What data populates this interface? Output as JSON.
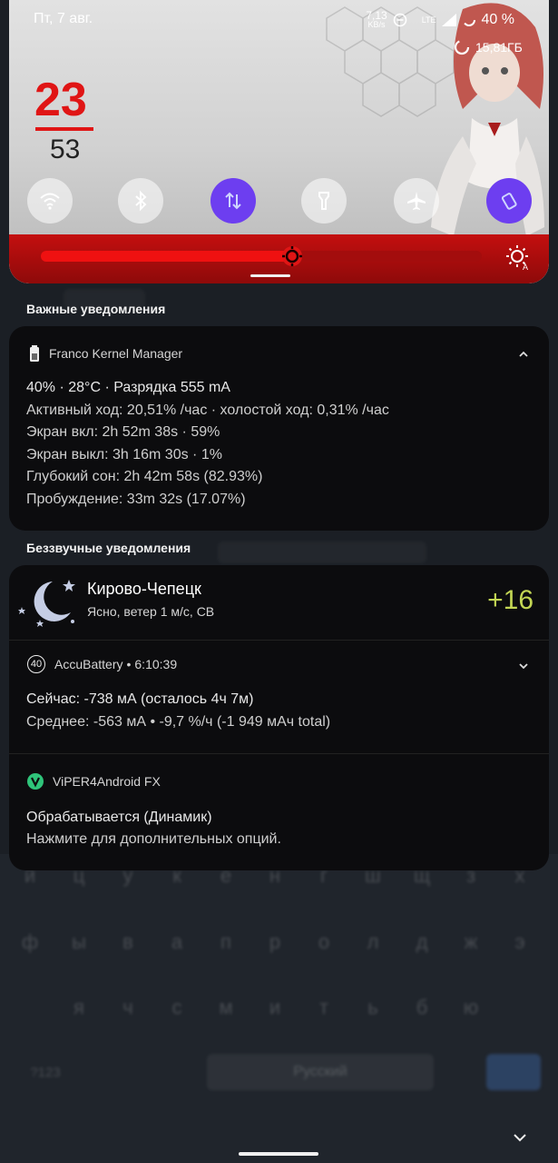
{
  "status_bar": {
    "date": "Пт, 7 авг.",
    "net_speed_value": "7,13",
    "net_speed_unit": "KB/s",
    "network": "LTE",
    "battery": "40 %"
  },
  "quick_settings": {
    "storage": "15,81ГБ",
    "clock_hour": "23",
    "clock_minute": "53",
    "tiles": [
      {
        "name": "wifi",
        "icon": "wifi-icon",
        "active": false
      },
      {
        "name": "bluetooth",
        "icon": "bluetooth-icon",
        "active": false
      },
      {
        "name": "mobile-data",
        "icon": "data-transfer-icon",
        "active": true
      },
      {
        "name": "flashlight",
        "icon": "flashlight-icon",
        "active": false
      },
      {
        "name": "airplane-mode",
        "icon": "airplane-icon",
        "active": false
      },
      {
        "name": "screen-rotation",
        "icon": "rotate-icon",
        "active": true
      }
    ],
    "brightness_level": 0.57,
    "accent_color": "#e01515",
    "active_tile_color": "#6d3ef0"
  },
  "sections": {
    "important": "Важные уведомления",
    "silent": "Беззвучные уведомления"
  },
  "franco": {
    "app_name": "Franco Kernel Manager",
    "lines": [
      "40% · 28°C · Разрядка 555 mA",
      "Активный ход: 20,51% /час · холостой ход: 0,31% /час",
      "Экран вкл: 2h 52m 38s  · 59%",
      "Экран выкл: 3h 16m 30s  · 1%",
      "Глубокий сон: 2h 42m 58s  (82.93%)",
      "Пробуждение: 33m 32s  (17.07%)"
    ]
  },
  "weather": {
    "title": "Кирово-Чепецк",
    "subtitle": "Ясно, ветер 1 м/с, СВ",
    "temperature": "+16"
  },
  "accubattery": {
    "app_name": "AccuBattery",
    "time": "6:10:39",
    "badge": "40",
    "line1": "Сейчас: -738 мА (осталось 4ч 7м)",
    "line2": "Среднее: -563 мА • -9,7 %/ч (-1 949 мАч total)"
  },
  "viper": {
    "app_name": "ViPER4Android FX",
    "title": "Обрабатывается (Динамик)",
    "subtitle": "Нажмите для дополнительных опций."
  },
  "keyboard": {
    "row1": [
      "й",
      "ц",
      "у",
      "к",
      "е",
      "н",
      "г",
      "ш",
      "щ",
      "з",
      "х"
    ],
    "row2": [
      "ф",
      "ы",
      "в",
      "а",
      "п",
      "р",
      "о",
      "л",
      "д",
      "ж",
      "э"
    ],
    "row3": [
      "я",
      "ч",
      "с",
      "м",
      "и",
      "т",
      "ь",
      "б",
      "ю"
    ],
    "symbols": "?123",
    "space": "Русский"
  }
}
